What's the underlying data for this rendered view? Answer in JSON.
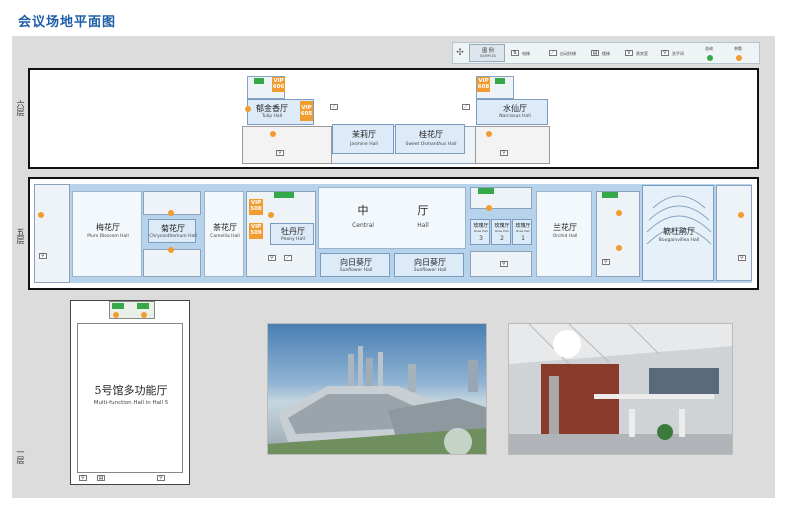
{
  "title": "会议场地平面图",
  "floor_labels": {
    "f6": "六层",
    "f5": "五层",
    "f1": "一层"
  },
  "legend": {
    "title_cn": "图 例",
    "title_en": "SAMPLES",
    "items": [
      "电梯",
      "自动扶梯",
      "楼梯",
      "贵宾室",
      "洗手间",
      "咨询",
      "茶歇"
    ],
    "colors": {
      "green": "#37a84a",
      "orange": "#f29b2f",
      "hall": "#dcebf7",
      "corridor": "#b7d3ec"
    }
  },
  "floor6": {
    "vip_top_left": "VIP 606",
    "vip_top_right": "VIP 608",
    "tulip_cn": "郁金香厅",
    "tulip_en": "Tulip Hall",
    "vip_mid": "VIP 605",
    "narcissus_cn": "水仙厅",
    "narcissus_en": "Narcissus Hall",
    "jasmine_cn": "茉莉厅",
    "jasmine_en": "Jasmine Hall",
    "osmanthus_cn": "桂花厅",
    "osmanthus_en": "Sweet Osmanthus Hall"
  },
  "floor5": {
    "plum_cn": "梅花厅",
    "plum_en": "Plum Blossom Hall",
    "chrys_cn": "菊花厅",
    "chrys_en": "Chrysanthemum Hall",
    "camellia_cn": "茶花厅",
    "camellia_en": "Camellia Hall",
    "vip_a": "VIP 508",
    "vip_b": "VIP 509",
    "peony_cn": "牡丹厅",
    "peony_en": "Peony Hall",
    "central_cn1": "中",
    "central_cn2": "厅",
    "central_en1": "Central",
    "central_en2": "Hall",
    "sunflower_cn": "向日葵厅",
    "sunflower_en": "Sunflower Hall",
    "rose_cn": "玫瑰厅",
    "rose_en": "Rose Hall",
    "rose_nums": [
      "3",
      "2",
      "1"
    ],
    "orchid_cn": "兰花厅",
    "orchid_en": "Orchid Hall",
    "bougain_cn": "簕杜鹃厅",
    "bougain_en": "Bougainvillea Hall"
  },
  "floor1": {
    "hall5_cn": "5号馆多功能厅",
    "hall5_en": "Multi-function Hall in Hall 5"
  },
  "photos": {
    "exterior": "exterior-aerial-view",
    "interior": "interior-lobby-view"
  }
}
